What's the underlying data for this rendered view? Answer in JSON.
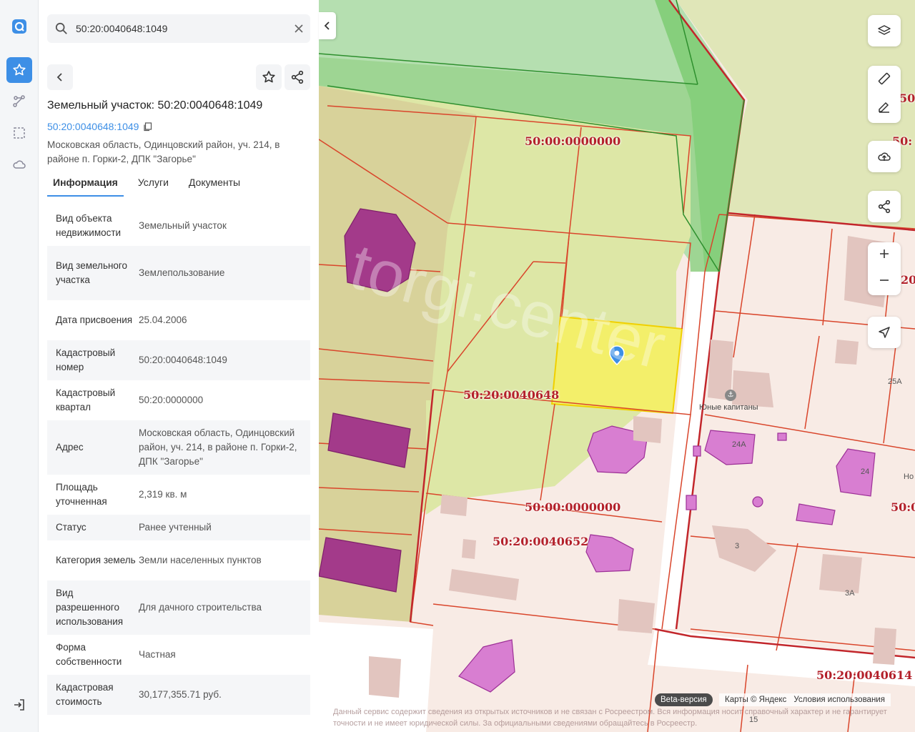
{
  "search": {
    "value": "50:20:0040648:1049"
  },
  "card": {
    "title": "Земельный участок: 50:20:0040648:1049",
    "cad_link": "50:20:0040648:1049",
    "address": "Московская область, Одинцовский район, уч. 214, в районе п. Горки-2, ДПК \"Загорье\""
  },
  "tabs": [
    {
      "label": "Информация"
    },
    {
      "label": "Услуги"
    },
    {
      "label": "Документы"
    }
  ],
  "rows": [
    {
      "key": "Вид объекта недвижимости",
      "value": "Земельный участок"
    },
    {
      "key": "Вид земельного участка",
      "value": "Землепользование"
    },
    {
      "key": "Дата присвоения",
      "value": "25.04.2006"
    },
    {
      "key": "Кадастровый номер",
      "value": "50:20:0040648:1049"
    },
    {
      "key": "Кадастровый квартал",
      "value": "50:20:0000000"
    },
    {
      "key": "Адрес",
      "value": "Московская область, Одинцовский район, уч. 214, в районе п. Горки-2, ДПК \"Загорье\""
    },
    {
      "key": "Площадь уточненная",
      "value": "2,319 кв. м"
    },
    {
      "key": "Статус",
      "value": "Ранее учтенный"
    },
    {
      "key": "Категория земель",
      "value": "Земли населенных пунктов"
    },
    {
      "key": "Вид разрешенного использования",
      "value": "Для дачного строительства"
    },
    {
      "key": "Форма собственности",
      "value": "Частная"
    },
    {
      "key": "Кадастровая стоимость",
      "value": "30,177,355.71 руб."
    }
  ],
  "map": {
    "labels": {
      "q1": "50:00:0000000",
      "q2": "50:20:0040648",
      "q3": "50:00:0000000",
      "q4": "50:20:0040652",
      "q5": "50:20:0040614",
      "edge1": "50:",
      "edge2": "50:",
      "edge3": "20:",
      "edge4": "50:0"
    },
    "place": "Юные капитаны",
    "house_numbers": {
      "h1": "24А",
      "h2": "24",
      "h3": "25А",
      "h4": "3",
      "h5": "3А",
      "h6": "15",
      "h7": "Но"
    },
    "watermark": "torgi.center",
    "beta": "Beta-версия",
    "attribution": {
      "maps": "Карты © Яндекс",
      "terms": "Условия использования"
    },
    "disclaimer": "Данный сервис содержит сведения из открытых источников и не связан с Росреестром. Вся информация носит справочный характер и не гарантирует точности и не имеет юридической силы. За официальными сведениями обращайтесь в Росреестр."
  },
  "colors": {
    "accent": "#3d8fe6",
    "boundary": "#d9452b",
    "selected": "#f3ef6a",
    "building": "#a33a8a"
  }
}
